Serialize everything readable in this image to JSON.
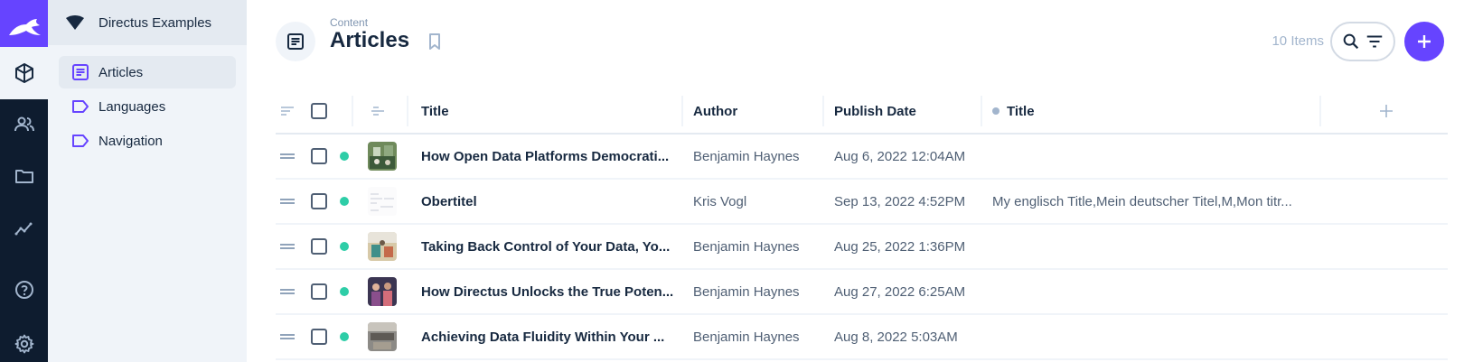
{
  "project": {
    "name": "Directus Examples"
  },
  "module_bar": [
    "content-icon",
    "users-icon",
    "files-icon",
    "insights-icon",
    "help-icon",
    "settings-icon"
  ],
  "nav": {
    "items": [
      {
        "label": "Articles",
        "icon": "list-icon",
        "active": true
      },
      {
        "label": "Languages",
        "icon": "label-icon",
        "active": false
      },
      {
        "label": "Navigation",
        "icon": "label-icon",
        "active": false
      }
    ]
  },
  "header": {
    "breadcrumb": "Content",
    "title": "Articles",
    "items_count": "10 Items"
  },
  "colors": {
    "accent": "#6644ff",
    "status_published": "#2ecda7",
    "sidebar": "#0e1c2f"
  },
  "table": {
    "columns": [
      "Title",
      "Author",
      "Publish Date",
      "Title"
    ],
    "rows": [
      {
        "title": "How Open Data Platforms Democrati...",
        "author": "Benjamin Haynes",
        "date": "Aug 6, 2022 12:04AM",
        "translations": "",
        "thumb": "photo-green"
      },
      {
        "title": "Obertitel",
        "author": "Kris Vogl",
        "date": "Sep 13, 2022 4:52PM",
        "translations": "My englisch Title,Mein deutscher Titel,M,Mon titr...",
        "thumb": "document-light"
      },
      {
        "title": "Taking Back Control of Your Data, Yo...",
        "author": "Benjamin Haynes",
        "date": "Aug 25, 2022 1:36PM",
        "translations": "",
        "thumb": "photo-office"
      },
      {
        "title": "How Directus Unlocks the True Poten...",
        "author": "Benjamin Haynes",
        "date": "Aug 27, 2022 6:25AM",
        "translations": "",
        "thumb": "photo-people"
      },
      {
        "title": "Achieving Data Fluidity Within Your ...",
        "author": "Benjamin Haynes",
        "date": "Aug 8, 2022 5:03AM",
        "translations": "",
        "thumb": "photo-room"
      }
    ]
  }
}
